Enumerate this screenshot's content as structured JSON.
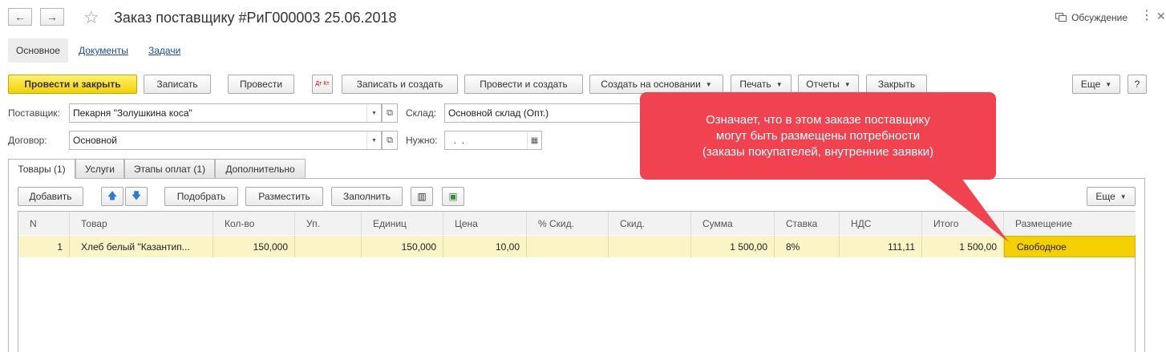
{
  "window": {
    "title": "Заказ поставщику #РиГ000003 25.06.2018",
    "discussion_label": "Обсуждение",
    "nav_back_icon": "←",
    "nav_forward_icon": "→",
    "favorite_icon": "☆",
    "more_icon": "⋮",
    "close_icon": "✕"
  },
  "section_tabs": {
    "main": "Основное",
    "documents": "Документы",
    "tasks": "Задачи"
  },
  "toolbar": {
    "post_and_close": "Провести и закрыть",
    "save": "Записать",
    "post": "Провести",
    "dt_kt_icon": "Дт Кт",
    "save_and_create": "Записать и создать",
    "post_and_create": "Провести и создать",
    "create_based_on": "Создать на основании",
    "print": "Печать",
    "reports": "Отчеты",
    "close": "Закрыть",
    "more": "Еще",
    "help": "?"
  },
  "form": {
    "supplier_label": "Поставщик:",
    "supplier_value": "Пекарня \"Золушкина коса\"",
    "warehouse_label": "Склад:",
    "warehouse_value": "Основной склад (Опт.)",
    "contract_label": "Договор:",
    "contract_value": "Основной",
    "needed_label": "Нужно:",
    "needed_value": "  .  ."
  },
  "tabs": {
    "goods": "Товары (1)",
    "services": "Услуги",
    "payment_stages": "Этапы оплат (1)",
    "additional": "Дополнительно"
  },
  "table_toolbar": {
    "add": "Добавить",
    "pick": "Подобрать",
    "place": "Разместить",
    "fill": "Заполнить",
    "more": "Еще"
  },
  "table": {
    "columns": [
      "N",
      "Товар",
      "Кол-во",
      "Уп.",
      "Единиц",
      "Цена",
      "% Скид.",
      "Скид.",
      "Сумма",
      "Ставка",
      "НДС",
      "Итого",
      "Размещение"
    ],
    "rows": [
      {
        "n": "1",
        "product": "Хлеб белый \"Казантип...",
        "qty": "150,000",
        "pack": "",
        "units": "150,000",
        "price": "10,00",
        "discount_pct": "",
        "discount": "",
        "sum": "1 500,00",
        "rate": "8%",
        "vat": "111,11",
        "total": "1 500,00",
        "placement": "Свободное"
      }
    ]
  },
  "callout": {
    "line1": "Означает, что в этом заказе поставщику",
    "line2": "могут быть размещены потребности",
    "line3": "(заказы покупателей, внутренние заявки)"
  },
  "colors": {
    "primary_button": "#f2d200",
    "selected_row": "#fbf4c6",
    "selected_cell": "#f5d000",
    "callout": "#f0434f",
    "link": "#1b4ea8"
  }
}
